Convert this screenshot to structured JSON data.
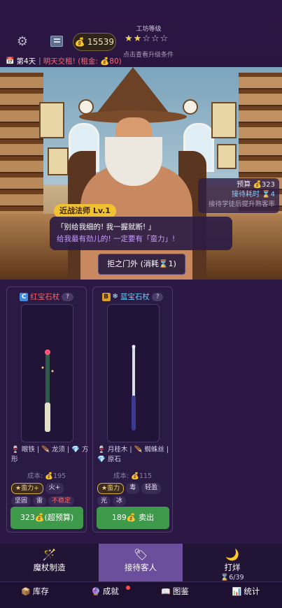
{
  "header": {
    "gold": "15539",
    "rank_label": "工坊等级",
    "stars_filled": 2,
    "stars_total": 5,
    "rank_hint": "点击查看升级条件",
    "day_label": "第4天",
    "rent_notice": "明天交租! (租金: 💰80)"
  },
  "scene": {
    "budget": "预算 💰323",
    "patience": "接待耗时 ⌛4",
    "skill_hint": "接待学徒后提升熟客率",
    "speaker": "近战法师 Lv.1",
    "dialog_line1": "「别给我细的! 我一握就断! 」",
    "dialog_line2": "给我最有劲儿的! 一定要有「蛮力」!",
    "reject_button": "拒之门外 (消耗⌛1)"
  },
  "cards": [
    {
      "grade": "C",
      "name": "红宝石杖",
      "question": "?",
      "materials_line1": "🍷 眼铁 | 🪶 龙须 | 💎 方",
      "materials_line2": "形",
      "cost": "成本: 💰195",
      "tags": [
        "★蛮力+",
        "火+",
        "坚固",
        "雷",
        "不稳定"
      ],
      "button": "323💰(超预算)"
    },
    {
      "grade": "B",
      "icon": "❄",
      "name": "蓝宝石杖",
      "question": "?",
      "materials_line1": "🍷 月桂木 | 🪶 蜘蛛丝 |",
      "materials_line2": "💎 原石",
      "cost": "成本: 💰115",
      "tags": [
        "★蛮力",
        "毒",
        "轻盈",
        "光",
        "冰"
      ],
      "button": "189💰 卖出"
    }
  ],
  "nav": {
    "craft": "魔杖制造",
    "serve": "接待客人",
    "close": "打烊",
    "close_sub": "⌛6/39",
    "inventory": "库存",
    "achievements": "成就",
    "catalog": "图鉴",
    "stats": "统计"
  },
  "colors": {
    "accent_active": "#6b4e9c",
    "sell_button": "#3e9a4a",
    "rent_red": "#ff6b6b"
  }
}
